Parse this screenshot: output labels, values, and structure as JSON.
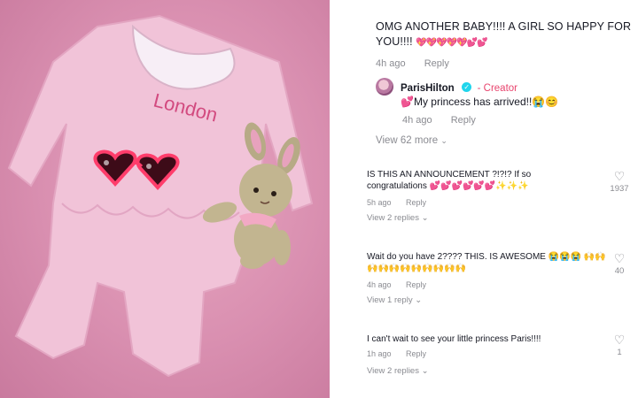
{
  "photo": {
    "onesie_text": "London",
    "colors": {
      "background": "#d98fb0",
      "onesie": "#f1c3d8",
      "collar": "#f7eef6"
    }
  },
  "top_comment": {
    "text": "OMG ANOTHER BABY!!!! A GIRL SO HAPPY FOR YOU!!!!",
    "emoji": "💖💖💖💖💖💕💕",
    "time": "4h ago",
    "reply": "Reply"
  },
  "creator_reply": {
    "username": "ParisHilton",
    "badge": "✓",
    "role": "- Creator",
    "text": "💕My princess has arrived!!😭😊",
    "time": "4h ago",
    "reply": "Reply"
  },
  "view_more": "View 62 more",
  "comments": [
    {
      "text": "IS THIS AN ANNOUNCEMENT ?!?!?  If so congratulations 💕💕💕💕💕💕✨✨✨",
      "time": "5h ago",
      "reply": "Reply",
      "likes": "1937",
      "replies": "View 2 replies"
    },
    {
      "text": "Wait do you have 2???? THIS. IS AWESOME 😭😭😭 🙌🙌🙌🙌🙌🙌🙌🙌🙌🙌🙌",
      "time": "4h ago",
      "reply": "Reply",
      "likes": "40",
      "replies": "View 1 reply"
    },
    {
      "text": "I can't wait to see your little princess Paris!!!!",
      "time": "1h ago",
      "reply": "Reply",
      "likes": "1",
      "replies": "View 2 replies"
    }
  ]
}
